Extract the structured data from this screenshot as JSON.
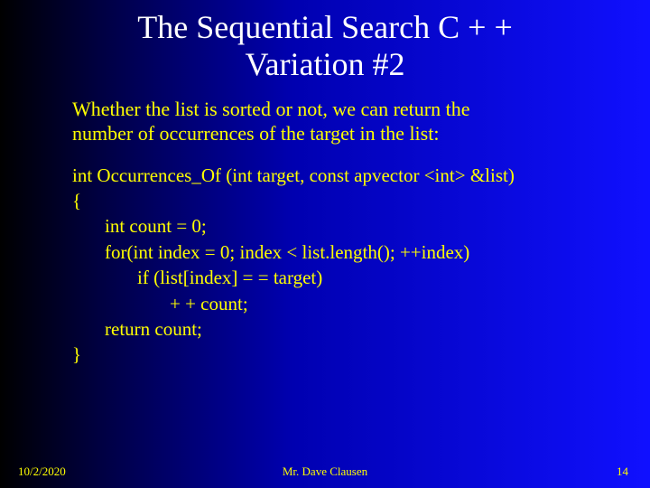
{
  "title_line1": "The Sequential Search C + +",
  "title_line2": "Variation #2",
  "intro_line1": "Whether  the list is sorted or not, we can return the",
  "intro_line2": "number of occurrences of the target in the list:",
  "code": {
    "sig": "int Occurrences_Of (int target, const apvector <int> &list)",
    "open": "{",
    "l1": "int count = 0;",
    "l2": "for(int index = 0; index < list.length(); ++index)",
    "l3": "if (list[index] = = target)",
    "l4": "+ + count;",
    "l5": "return count;",
    "close": "}"
  },
  "footer": {
    "date": "10/2/2020",
    "author": "Mr. Dave Clausen",
    "pageno": "14"
  }
}
